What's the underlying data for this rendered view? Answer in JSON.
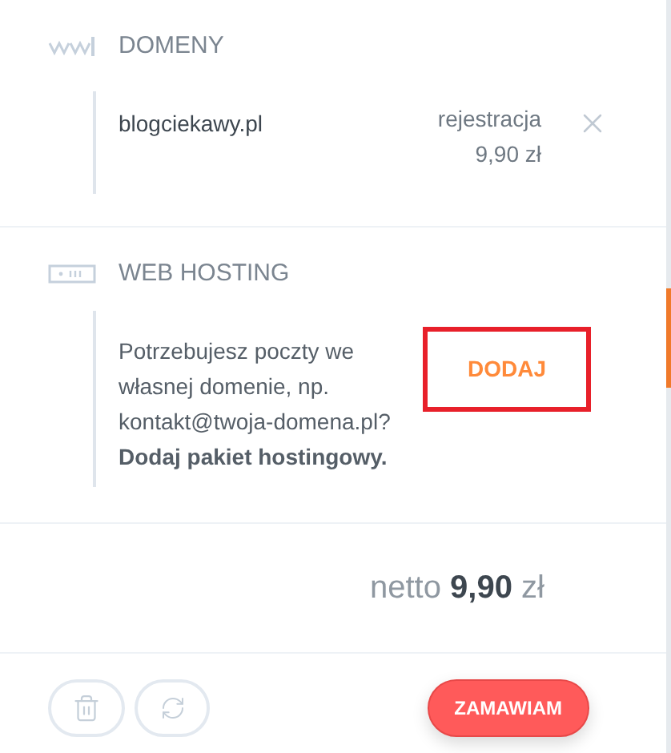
{
  "domains": {
    "title": "DOMENY",
    "items": [
      {
        "name": "blogciekawy.pl",
        "type": "rejestracja",
        "price": "9,90 zł"
      }
    ]
  },
  "hosting": {
    "title": "WEB HOSTING",
    "message": "Potrzebujesz poczty we własnej domenie, np. kontakt@twoja-domena.pl? **Dodaj pakiet hostingowy.**",
    "action": "DODAJ",
    "highlighted": true
  },
  "total": {
    "label": "netto",
    "amount": "9,90",
    "currency": "zł"
  },
  "order_button": "ZAMAWIAM"
}
